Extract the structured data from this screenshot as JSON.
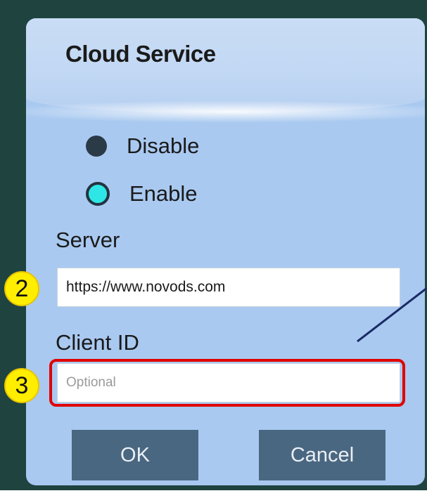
{
  "dialog": {
    "title": "Cloud Service",
    "radio_options": [
      {
        "label": "Disable",
        "selected": false
      },
      {
        "label": "Enable",
        "selected": true
      }
    ],
    "server": {
      "label": "Server",
      "value": "https://www.novods.com"
    },
    "client_id": {
      "label": "Client ID",
      "value": "",
      "placeholder": "Optional"
    },
    "buttons": {
      "ok": "OK",
      "cancel": "Cancel"
    }
  },
  "annotations": {
    "badge_server": "2",
    "badge_client_id": "3"
  },
  "colors": {
    "dialog_background": "#a9c9f0",
    "selected_radio": "#2ee6e6",
    "button": "#4a6781",
    "highlight": "#e00000",
    "badge": "#ffee00"
  }
}
